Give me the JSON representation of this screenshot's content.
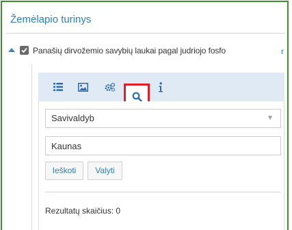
{
  "panel": {
    "title": "Žemėlapio turinys"
  },
  "layer": {
    "name": "Panašių dirvožemio savybių laukai pagal judriojo fosfo",
    "cut_glyph": "r",
    "checked": true
  },
  "tabs": [
    {
      "icon": "list-icon",
      "active": false
    },
    {
      "icon": "image-icon",
      "active": false
    },
    {
      "icon": "gears-icon",
      "active": false
    },
    {
      "icon": "search-icon",
      "active": true
    },
    {
      "icon": "info-icon",
      "active": false
    }
  ],
  "search": {
    "select_value": "Savivaldyb",
    "input_value": "Kaunas",
    "search_button": "Ieškoti",
    "clear_button": "Valyti",
    "results_text": "Rezultatų skaičius: 0"
  },
  "colors": {
    "frame_border": "#3c8f2a",
    "link_blue": "#2c7fbf",
    "highlight_red": "#e41e26",
    "tabs_bg": "#dfeaf5"
  }
}
